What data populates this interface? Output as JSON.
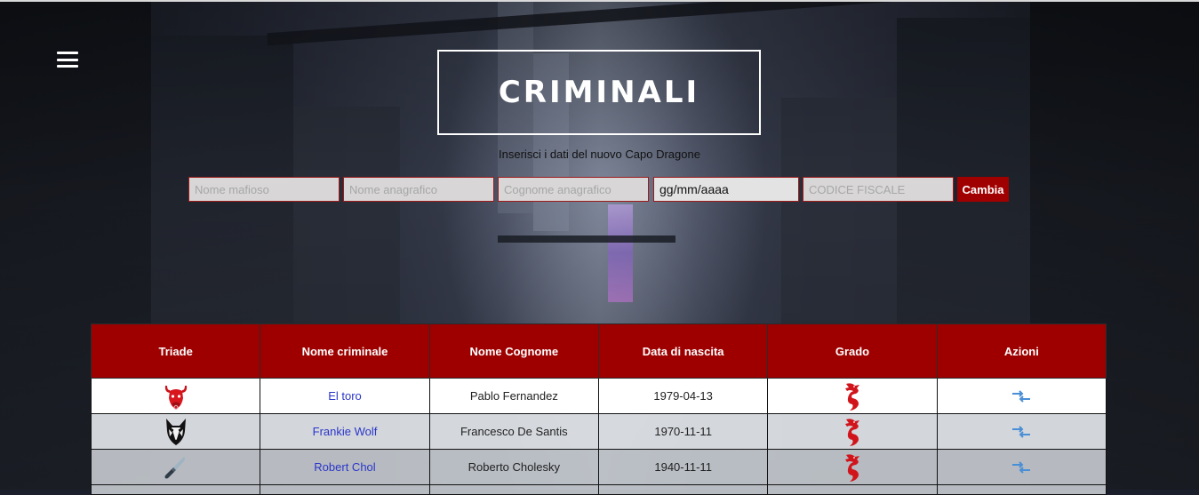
{
  "page": {
    "title": "CRIMINALI",
    "subtitle": "Inserisci i dati del nuovo Capo Dragone"
  },
  "form": {
    "nome_mafioso_placeholder": "Nome mafioso",
    "nome_anagrafico_placeholder": "Nome anagrafico",
    "cognome_anagrafico_placeholder": "Cognome anagrafico",
    "data_value": "gg/mm/aaaa",
    "codice_fiscale_placeholder": "CODICE FISCALE",
    "submit_label": "Cambia"
  },
  "table": {
    "headers": [
      "Triade",
      "Nome criminale",
      "Nome Cognome",
      "Data di nascita",
      "Grado",
      "Azioni"
    ],
    "rows": [
      {
        "triade_icon": "bull-icon",
        "nome_criminale": "El toro",
        "nome_cognome": "Pablo Fernandez",
        "data_nascita": "1979-04-13",
        "grado_icon": "red-dragon-icon",
        "azione_icon": "swap-arrows-icon"
      },
      {
        "triade_icon": "wolf-icon",
        "nome_criminale": "Frankie Wolf",
        "nome_cognome": "Francesco De Santis",
        "data_nascita": "1970-11-11",
        "grado_icon": "red-dragon-icon",
        "azione_icon": "swap-arrows-icon"
      },
      {
        "triade_icon": "knife-icon",
        "nome_criminale": "Robert Chol",
        "nome_cognome": "Roberto Cholesky",
        "data_nascita": "1940-11-11",
        "grado_icon": "red-dragon-icon",
        "azione_icon": "swap-arrows-icon"
      }
    ]
  },
  "colors": {
    "accent": "#9e0000",
    "link": "#2a36c9",
    "action": "#4a8fd6"
  }
}
